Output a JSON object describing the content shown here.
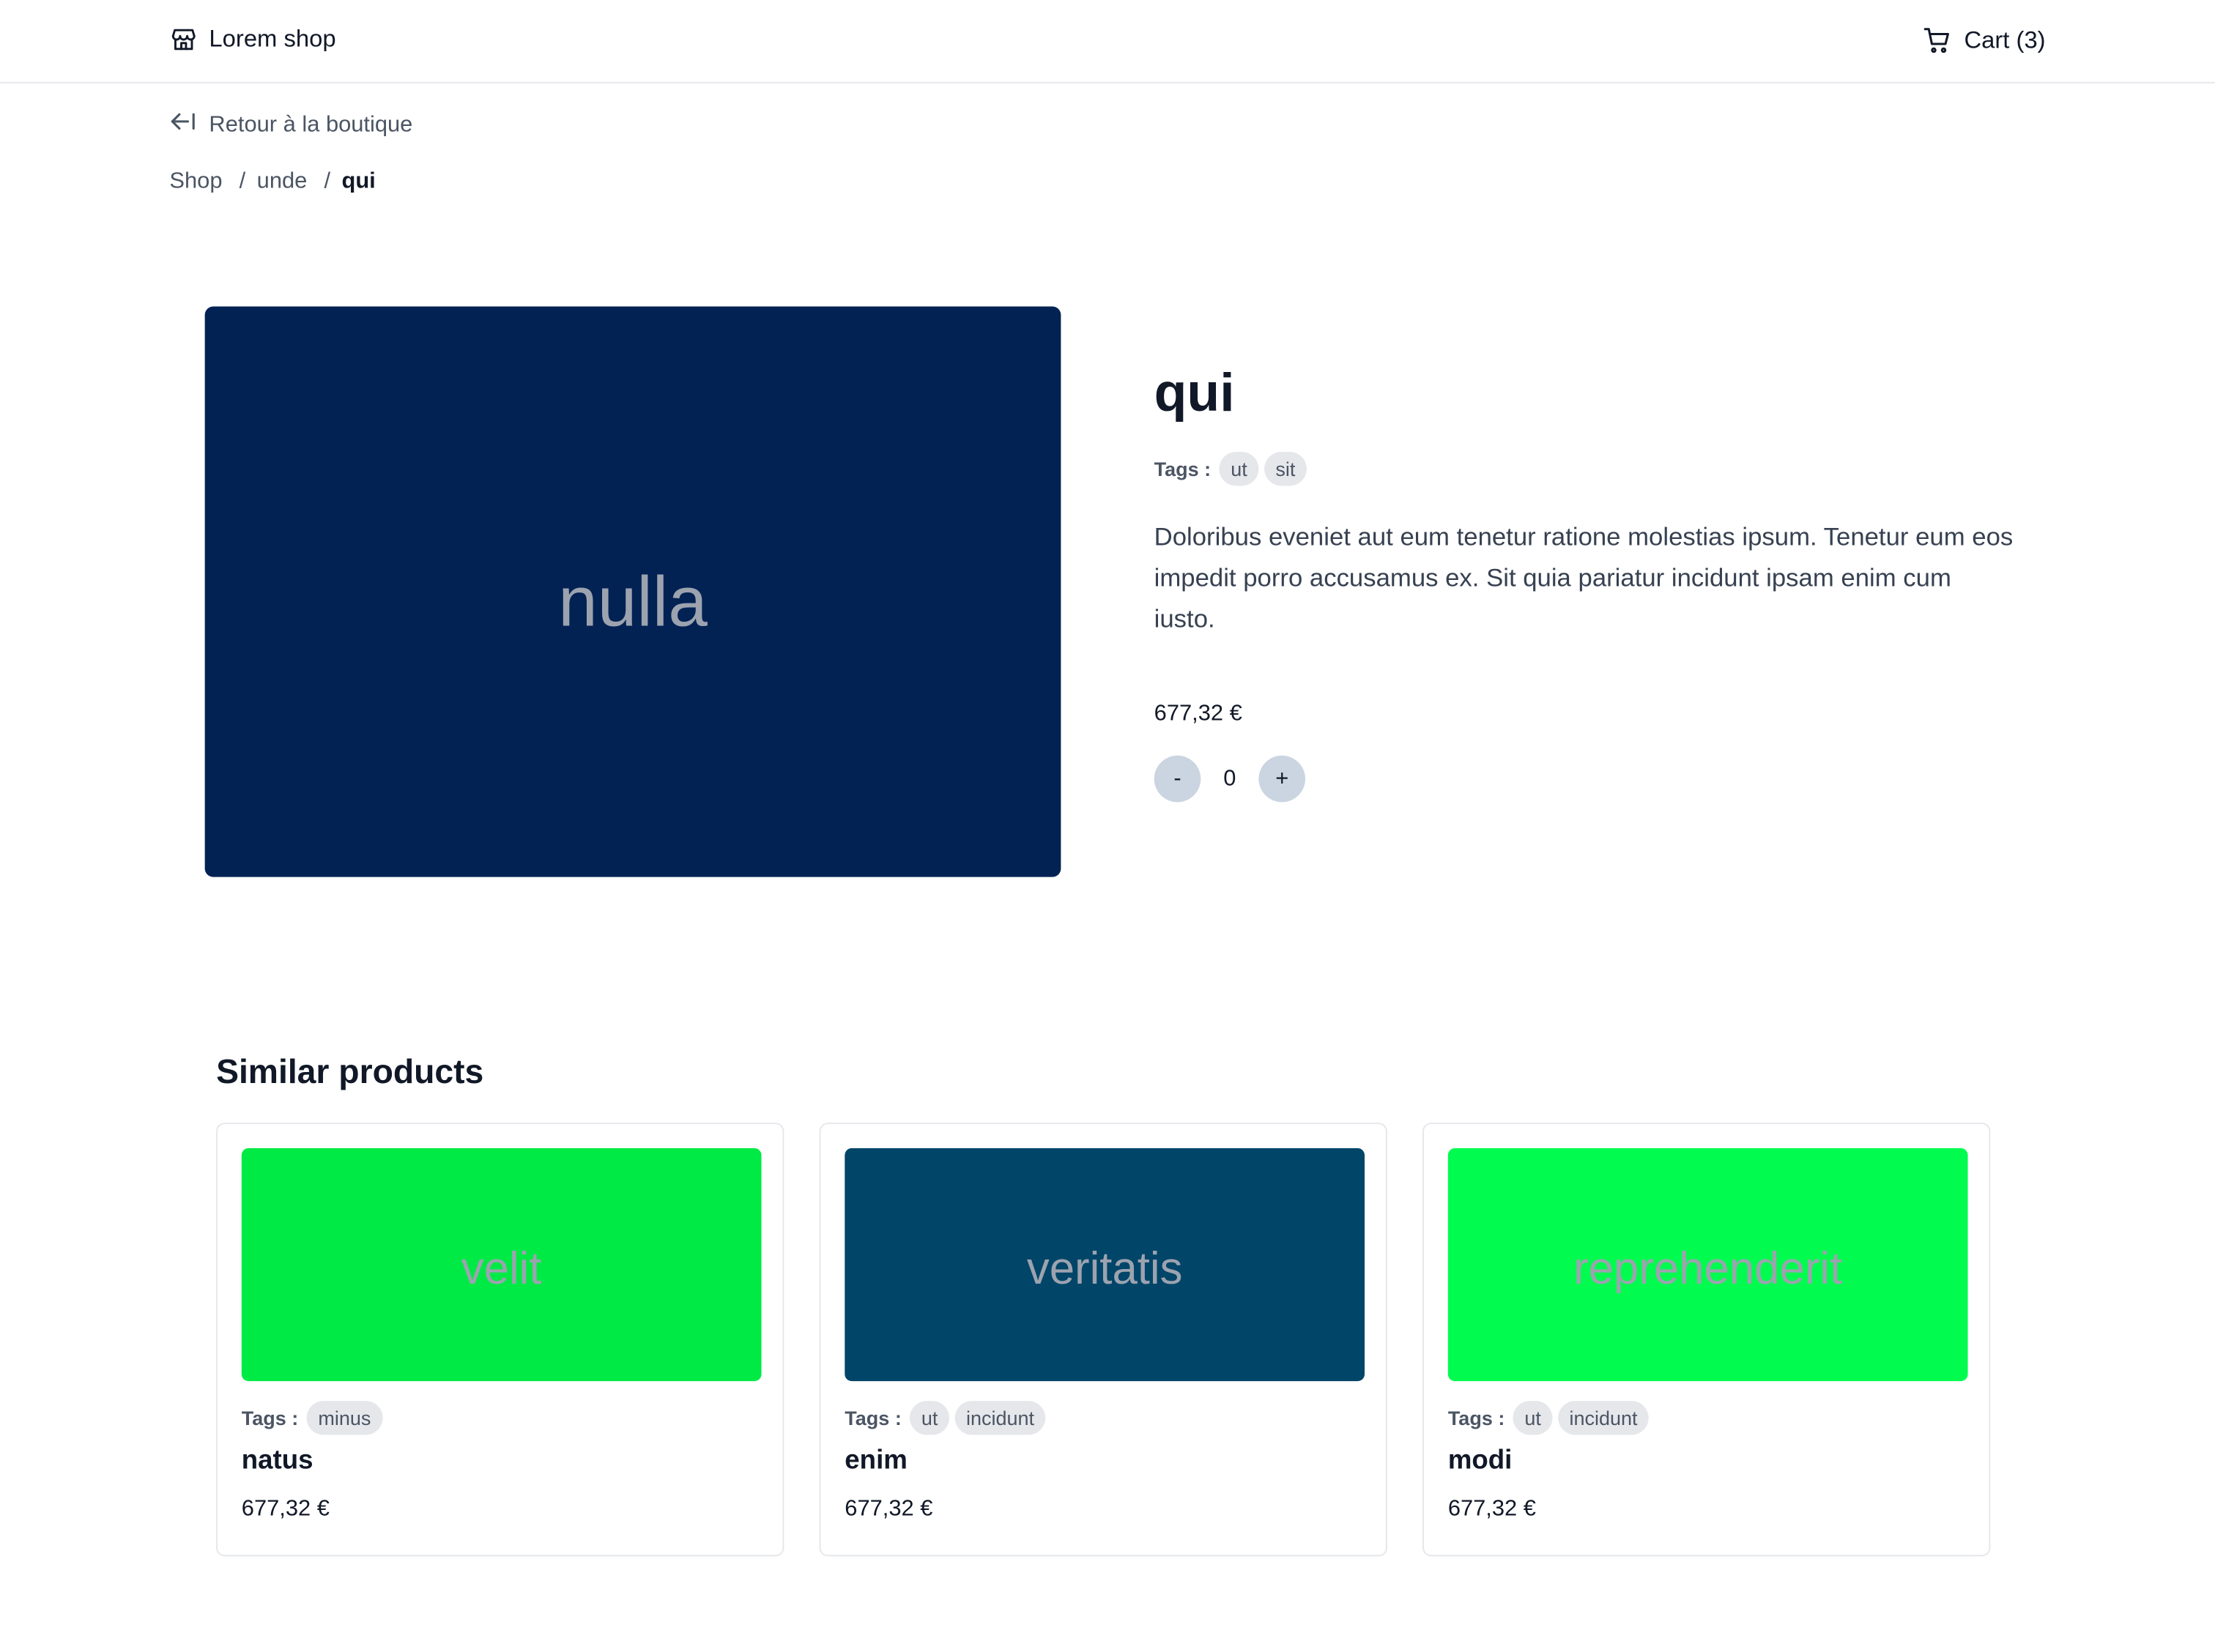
{
  "header": {
    "brand": "Lorem shop",
    "cart_label": "Cart (3)"
  },
  "back_link": "Retour à la boutique",
  "breadcrumb": {
    "items": [
      "Shop",
      "unde",
      "qui"
    ],
    "separator": "/"
  },
  "product": {
    "image_text": "nulla",
    "image_color": "#022254",
    "title": "qui",
    "tags_label": "Tags :",
    "tags": [
      "ut",
      "sit"
    ],
    "description": "Doloribus eveniet aut eum tenetur ratione molestias ipsum. Tenetur eum eos impedit porro accusamus ex. Sit quia pariatur incidunt ipsam enim cum iusto.",
    "price": "677,32 €",
    "quantity": {
      "minus_label": "-",
      "value": "0",
      "plus_label": "+"
    }
  },
  "similar": {
    "title": "Similar products",
    "items": [
      {
        "image_text": "velit",
        "image_color": "#00ea45",
        "tags_label": "Tags :",
        "tags": [
          "minus"
        ],
        "name": "natus",
        "price": "677,32 €"
      },
      {
        "image_text": "veritatis",
        "image_color": "#014569",
        "tags_label": "Tags :",
        "tags": [
          "ut",
          "incidunt"
        ],
        "name": "enim",
        "price": "677,32 €"
      },
      {
        "image_text": "reprehenderit",
        "image_color": "#01fc4f",
        "tags_label": "Tags :",
        "tags": [
          "ut",
          "incidunt"
        ],
        "name": "modi",
        "price": "677,32 €"
      }
    ]
  },
  "colors": {
    "text_dark": "#111827",
    "text_muted": "#4b5563",
    "tag_bg": "#e5e7eb",
    "qty_btn_bg": "#cbd5e1",
    "border": "#e5e7eb"
  }
}
